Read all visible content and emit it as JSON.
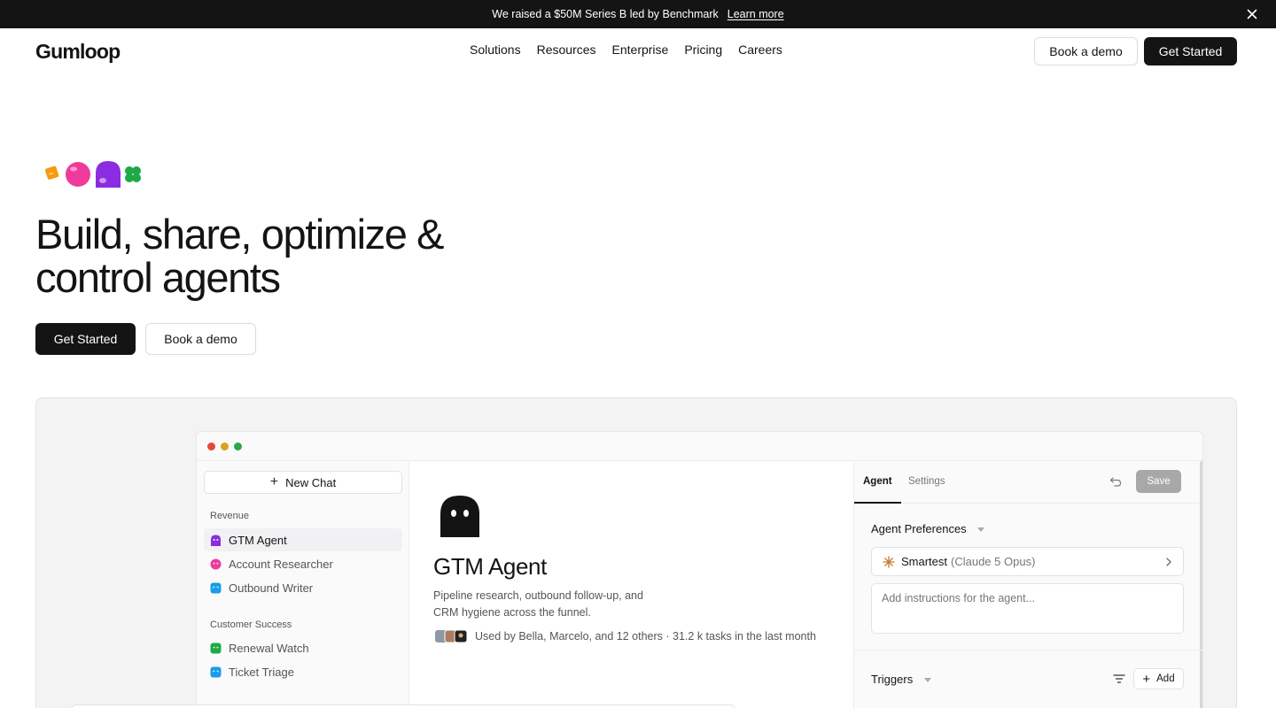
{
  "announcement": {
    "text": "We raised a $50M Series B led by Benchmark",
    "link": "Learn more"
  },
  "header": {
    "logo": "Gumloop",
    "nav": [
      "Solutions",
      "Resources",
      "Enterprise",
      "Pricing",
      "Careers"
    ],
    "book_demo": "Book a demo",
    "get_started": "Get Started"
  },
  "hero": {
    "title_line1": "Build, share, optimize &",
    "title_line2": "control agents",
    "get_started": "Get Started",
    "book_demo": "Book a demo"
  },
  "app": {
    "new_chat": "New Chat",
    "sections": [
      {
        "label": "Revenue",
        "items": [
          "GTM Agent",
          "Account Researcher",
          "Outbound Writer"
        ]
      },
      {
        "label": "Customer Success",
        "items": [
          "Renewal Watch",
          "Ticket Triage"
        ]
      }
    ],
    "agent": {
      "title": "GTM Agent",
      "description": "Pipeline research, outbound follow-up, and CRM hygiene across the funnel.",
      "usage": "Used by Bella, Marcelo, and 12 others · 31.2 k tasks in the last month"
    },
    "panel": {
      "tab_agent": "Agent",
      "tab_settings": "Settings",
      "save": "Save",
      "preferences_label": "Agent Preferences",
      "model_name": "Smartest",
      "model_detail": "(Claude 5 Opus)",
      "instructions_placeholder": "Add instructions for the agent...",
      "triggers_label": "Triggers",
      "add": "Add"
    }
  },
  "colors": {
    "ink": "#141414",
    "agent_purple": "#8b2be2",
    "pink": "#ee3b9c",
    "orange": "#f79a10",
    "green": "#1eaa46",
    "blue": "#1a9ce8"
  }
}
